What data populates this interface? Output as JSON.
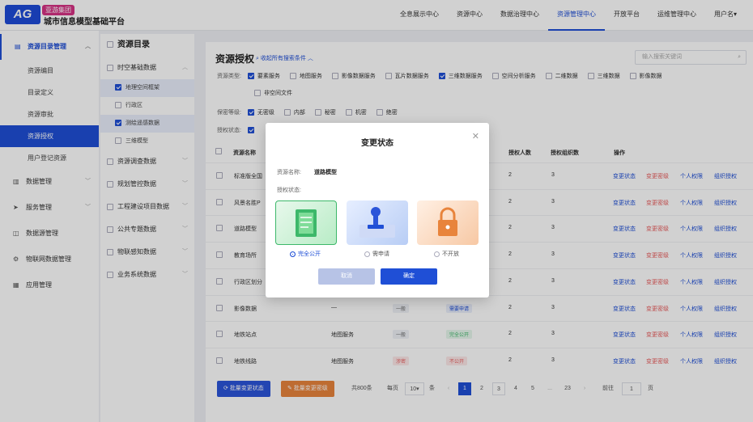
{
  "brand": {
    "logo": "AG",
    "sub": "亚游集团",
    "title": "城市信息模型基础平台"
  },
  "nav": [
    "全息展示中心",
    "资源中心",
    "数据治理中心",
    "资源管理中心",
    "开放平台",
    "运维管理中心",
    "用户名"
  ],
  "sidebar": {
    "group_open": "资源目录管理",
    "subs": [
      "资源编目",
      "目录定义",
      "资源审批",
      "资源授权",
      "用户登记资源"
    ],
    "items": [
      "数据管理",
      "服务管理",
      "数据源管理",
      "物联网数据管理",
      "应用管理"
    ]
  },
  "tree": {
    "title": "资源目录",
    "node_open": "时空基础数据",
    "leaves": [
      "地理空间框架",
      "行政区",
      "测绘遥感数据",
      "三维模型"
    ],
    "nodes": [
      "资源调查数据",
      "规划管控数据",
      "工程建设项目数据",
      "公共专题数据",
      "物联感知数据",
      "业务系统数据"
    ]
  },
  "main": {
    "title": "资源授权",
    "collapse": "收起所有搜索条件",
    "search_placeholder": "输入搜索关键词",
    "filter_type_label": "资源类型:",
    "filter_types": [
      "要素服务",
      "地图服务",
      "影像数据服务",
      "瓦片数据服务",
      "三维数据服务",
      "空间分析服务",
      "二维数据",
      "三维数据",
      "影像数据",
      "非空间文件"
    ],
    "filter_secret_label": "保密等级:",
    "filter_secrets": [
      "无密级",
      "内部",
      "秘密",
      "机密",
      "绝密"
    ],
    "filter_auth_label": "授权状态:",
    "columns": [
      "资源名称",
      "授权人数",
      "授权组织数",
      "操作"
    ],
    "rows": [
      {
        "name": "标准版全国",
        "people": "2",
        "orgs": "3"
      },
      {
        "name": "风景名胜P",
        "people": "2",
        "orgs": "3"
      },
      {
        "name": "道路模型",
        "people": "2",
        "orgs": "3"
      },
      {
        "name": "教育场所",
        "people": "2",
        "orgs": "3"
      },
      {
        "name": "行政区划分",
        "people": "2",
        "orgs": "3"
      },
      {
        "name": "影像数据",
        "type": "—",
        "level": "一般",
        "status": "需要申请",
        "people": "2",
        "orgs": "3"
      },
      {
        "name": "地铁站点",
        "type": "地图服务",
        "level": "一般",
        "status": "完全公开",
        "people": "2",
        "orgs": "3"
      },
      {
        "name": "地铁线路",
        "type": "地图服务",
        "level": "涉密",
        "status": "不公开",
        "people": "2",
        "orgs": "3"
      }
    ],
    "actions": [
      "变更状态",
      "变更密级",
      "个人权限",
      "组织授权"
    ],
    "batch_status": "批量变更状态",
    "batch_secret": "批量变更密级",
    "pagination": {
      "total": "共800条",
      "per_page_label": "每页",
      "per_page": "10",
      "unit": "条",
      "pages": [
        "1",
        "2",
        "3",
        "4",
        "5",
        "23"
      ],
      "ellipsis": "...",
      "goto_label": "前往",
      "goto_value": "1",
      "page_unit": "页"
    }
  },
  "modal": {
    "title": "变更状态",
    "name_label": "资源名称:",
    "name_value": "道路模型",
    "status_label": "授权状态:",
    "options": [
      "完全公开",
      "需申请",
      "不开放"
    ],
    "selected": "完全公开",
    "cancel": "取消",
    "confirm": "确定"
  },
  "colors": {
    "primary": "#1f4fd6",
    "danger": "#e85c5c",
    "green": "#3db86a",
    "orange": "#e8843c"
  }
}
